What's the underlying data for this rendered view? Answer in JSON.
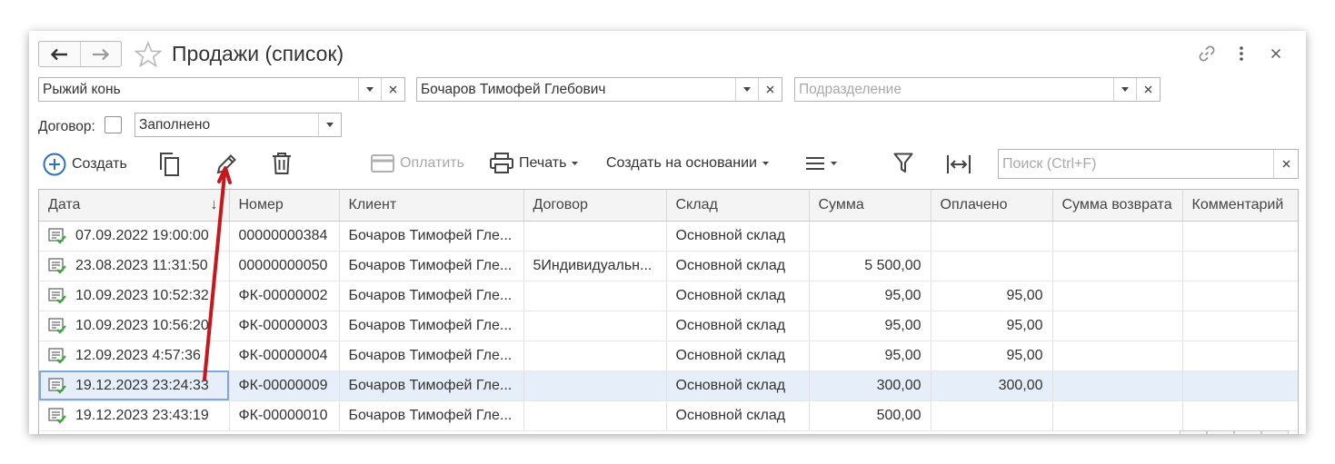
{
  "window": {
    "title": "Продажи (список)"
  },
  "filters": {
    "organization": {
      "value": "Рыжий конь",
      "placeholder": ""
    },
    "manager": {
      "value": "Бочаров Тимофей Глебович",
      "placeholder": ""
    },
    "department": {
      "value": "",
      "placeholder": "Подразделение"
    },
    "contract_label": "Договор:",
    "contract_state": {
      "value": "Заполнено"
    }
  },
  "toolbar": {
    "create_label": "Создать",
    "pay_label": "Оплатить",
    "print_label": "Печать",
    "create_based_label": "Создать на основании",
    "search_placeholder": "Поиск (Ctrl+F)"
  },
  "table": {
    "columns": [
      "Дата",
      "Номер",
      "Клиент",
      "Договор",
      "Склад",
      "Сумма",
      "Оплачено",
      "Сумма возврата",
      "Комментарий"
    ],
    "sort_indicator": "↓",
    "rows": [
      {
        "date": "07.09.2022 19:00:00",
        "number": "00000000384",
        "client": "Бочаров Тимофей Гле...",
        "contract": "",
        "warehouse": "Основной склад",
        "sum": "",
        "paid": "",
        "refund": "",
        "comment": ""
      },
      {
        "date": "23.08.2023 11:31:50",
        "number": "00000000050",
        "client": "Бочаров Тимофей Гле...",
        "contract": "5Индивидуальн...",
        "warehouse": "Основной склад",
        "sum": "5 500,00",
        "paid": "",
        "refund": "",
        "comment": ""
      },
      {
        "date": "10.09.2023 10:52:32",
        "number": "ФК-00000002",
        "client": "Бочаров Тимофей Гле...",
        "contract": "",
        "warehouse": "Основной склад",
        "sum": "95,00",
        "paid": "95,00",
        "refund": "",
        "comment": ""
      },
      {
        "date": "10.09.2023 10:56:20",
        "number": "ФК-00000003",
        "client": "Бочаров Тимофей Гле...",
        "contract": "",
        "warehouse": "Основной склад",
        "sum": "95,00",
        "paid": "95,00",
        "refund": "",
        "comment": ""
      },
      {
        "date": "12.09.2023 4:57:36",
        "number": "ФК-00000004",
        "client": "Бочаров Тимофей Гле...",
        "contract": "",
        "warehouse": "Основной склад",
        "sum": "95,00",
        "paid": "95,00",
        "refund": "",
        "comment": ""
      },
      {
        "date": "19.12.2023 23:24:33",
        "number": "ФК-00000009",
        "client": "Бочаров Тимофей Гле...",
        "contract": "",
        "warehouse": "Основной склад",
        "sum": "300,00",
        "paid": "300,00",
        "refund": "",
        "comment": ""
      },
      {
        "date": "19.12.2023 23:43:19",
        "number": "ФК-00000010",
        "client": "Бочаров Тимофей Гле...",
        "contract": "",
        "warehouse": "Основной склад",
        "sum": "500,00",
        "paid": "",
        "refund": "",
        "comment": ""
      }
    ]
  },
  "colors": {
    "accent": "#2f6fbf",
    "selected_row": "#e5eef9",
    "annotation_arrow": "#c8161d",
    "doc_icon_check": "#3aa53a"
  },
  "icons": {
    "back": "arrow-left-icon",
    "forward": "arrow-right-icon",
    "favorite": "star-icon",
    "link": "link-icon",
    "more": "more-vertical-icon",
    "close": "close-icon",
    "create": "plus-circle-icon",
    "copy": "copy-icon",
    "edit": "pencil-icon",
    "delete": "trash-icon",
    "pay": "card-icon",
    "print": "printer-icon",
    "more_actions": "menu-icon",
    "filter": "funnel-icon",
    "column_width": "column-width-icon",
    "document": "document-posted-icon"
  }
}
